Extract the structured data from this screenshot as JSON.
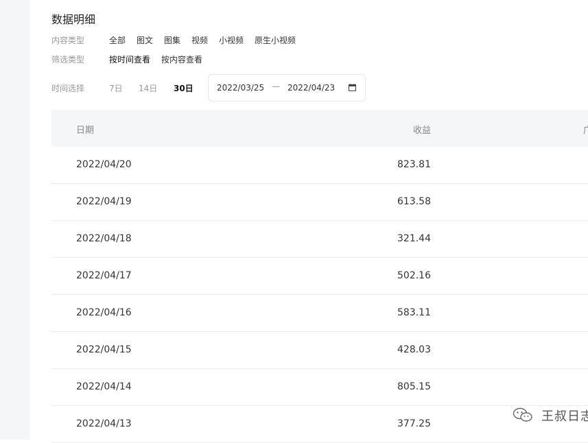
{
  "page": {
    "title": "数据明细"
  },
  "filters": {
    "content_type_label": "内容类型",
    "content_types": [
      "全部",
      "图文",
      "图集",
      "视频",
      "小视频",
      "原生小视频"
    ],
    "filter_type_label": "筛选类型",
    "filter_types": [
      "按时间查看",
      "按内容查看"
    ],
    "time_label": "时间选择",
    "time_options": [
      "7日",
      "14日",
      "30日"
    ],
    "time_selected": "30日",
    "date_start": "2022/03/25",
    "date_sep": "—",
    "date_end": "2022/04/23"
  },
  "table": {
    "headers": {
      "date": "日期",
      "income": "收益",
      "third": "广"
    },
    "rows": [
      {
        "date": "2022/04/20",
        "income": "823.81"
      },
      {
        "date": "2022/04/19",
        "income": "613.58"
      },
      {
        "date": "2022/04/18",
        "income": "321.44"
      },
      {
        "date": "2022/04/17",
        "income": "502.16"
      },
      {
        "date": "2022/04/16",
        "income": "583.11"
      },
      {
        "date": "2022/04/15",
        "income": "428.03"
      },
      {
        "date": "2022/04/14",
        "income": "805.15"
      },
      {
        "date": "2022/04/13",
        "income": "377.25"
      }
    ]
  },
  "watermark": {
    "text": "王叔日志",
    "icon": "wechat-icon"
  }
}
